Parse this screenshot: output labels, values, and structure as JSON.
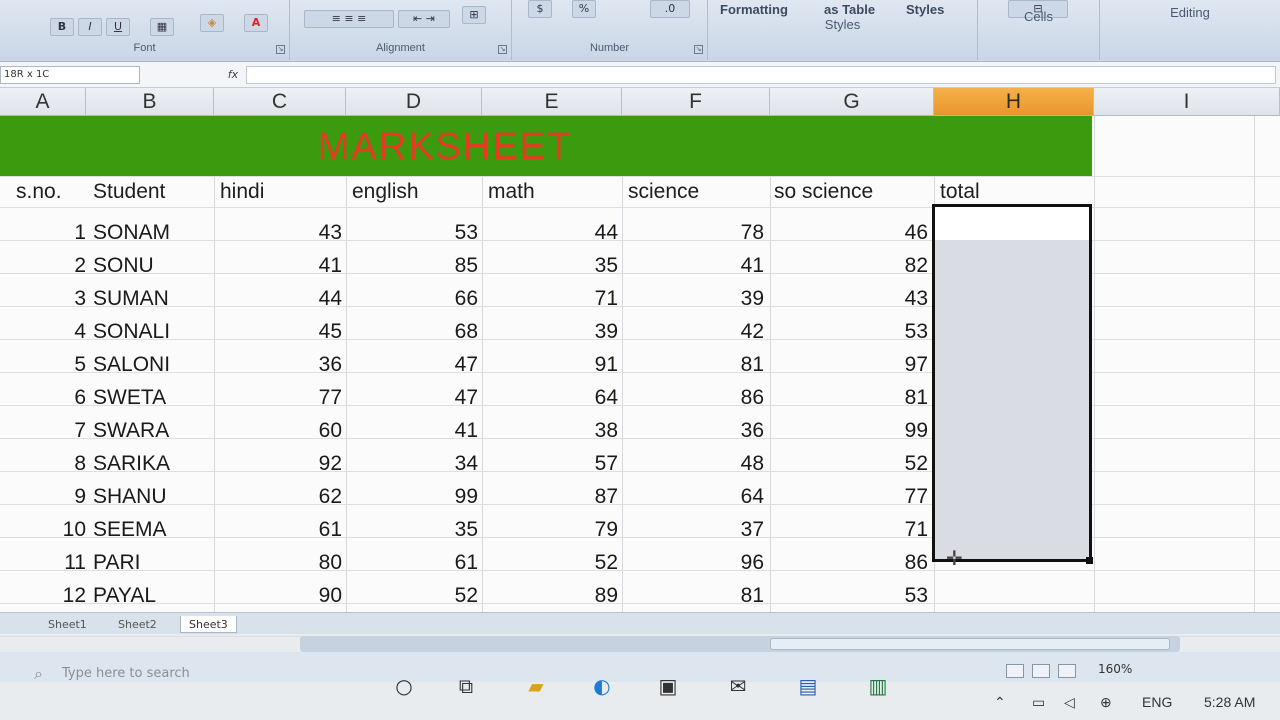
{
  "ribbon": {
    "group_labels": [
      "Font",
      "Alignment",
      "Number",
      "Styles",
      "Cells",
      "Editing"
    ],
    "styles_buttons": [
      "Formatting",
      "as Table",
      "Styles"
    ],
    "number_symbols": [
      "$",
      "%"
    ]
  },
  "formula_bar": {
    "name_box": "18R x 1C",
    "fx_label": "fx",
    "formula": ""
  },
  "columns": [
    "A",
    "B",
    "C",
    "D",
    "E",
    "F",
    "G",
    "H",
    "I"
  ],
  "selected_column": "H",
  "sheet": {
    "title": "MARKSHEET",
    "headers": [
      "s.no.",
      "Student",
      "hindi",
      "english",
      "math",
      "science",
      "so science",
      "total"
    ],
    "rows": [
      {
        "sno": "1",
        "student": "SONAM",
        "hindi": "43",
        "english": "53",
        "math": "44",
        "science": "78",
        "so_science": "46"
      },
      {
        "sno": "2",
        "student": "SONU",
        "hindi": "41",
        "english": "85",
        "math": "35",
        "science": "41",
        "so_science": "82"
      },
      {
        "sno": "3",
        "student": "SUMAN",
        "hindi": "44",
        "english": "66",
        "math": "71",
        "science": "39",
        "so_science": "43"
      },
      {
        "sno": "4",
        "student": "SONALI",
        "hindi": "45",
        "english": "68",
        "math": "39",
        "science": "42",
        "so_science": "53"
      },
      {
        "sno": "5",
        "student": "SALONI",
        "hindi": "36",
        "english": "47",
        "math": "91",
        "science": "81",
        "so_science": "97"
      },
      {
        "sno": "6",
        "student": "SWETA",
        "hindi": "77",
        "english": "47",
        "math": "64",
        "science": "86",
        "so_science": "81"
      },
      {
        "sno": "7",
        "student": "SWARA",
        "hindi": "60",
        "english": "41",
        "math": "38",
        "science": "36",
        "so_science": "99"
      },
      {
        "sno": "8",
        "student": "SARIKA",
        "hindi": "92",
        "english": "34",
        "math": "57",
        "science": "48",
        "so_science": "52"
      },
      {
        "sno": "9",
        "student": "SHANU",
        "hindi": "62",
        "english": "99",
        "math": "87",
        "science": "64",
        "so_science": "77"
      },
      {
        "sno": "10",
        "student": "SEEMA",
        "hindi": "61",
        "english": "35",
        "math": "79",
        "science": "37",
        "so_science": "71"
      },
      {
        "sno": "11",
        "student": "PARI",
        "hindi": "80",
        "english": "61",
        "math": "52",
        "science": "96",
        "so_science": "86"
      },
      {
        "sno": "12",
        "student": "PAYAL",
        "hindi": "90",
        "english": "52",
        "math": "89",
        "science": "81",
        "so_science": "53"
      }
    ]
  },
  "sheet_tabs": [
    "Sheet1",
    "Sheet2",
    "Sheet3"
  ],
  "active_tab": "Sheet3",
  "status": {
    "zoom": "160%"
  },
  "taskbar": {
    "search_placeholder": "Type here to search",
    "language": "ENG",
    "time": "5:28 AM"
  },
  "colors": {
    "title_band": "#3b9a0d",
    "title_text": "#e53b22",
    "selected_header": "#e9952a"
  }
}
